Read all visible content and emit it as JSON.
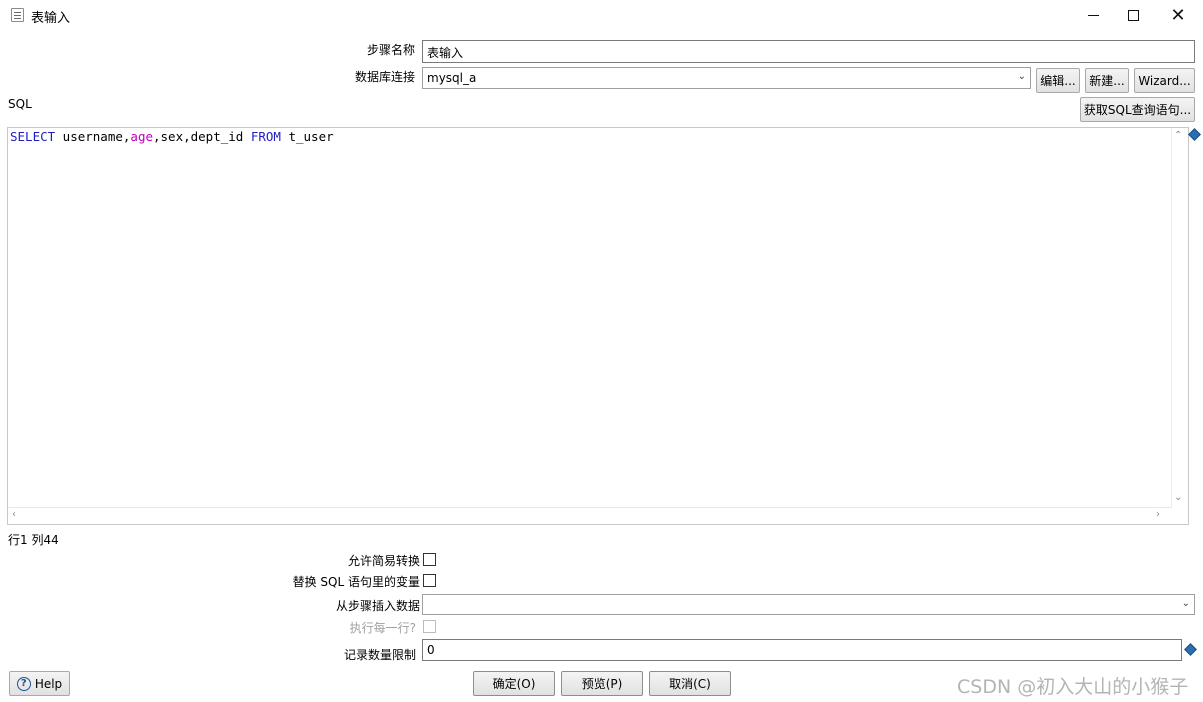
{
  "window": {
    "title": "表输入",
    "controls": {
      "minimize_icon": "minimize-icon",
      "maximize_icon": "maximize-icon",
      "close_icon": "close-icon"
    }
  },
  "form": {
    "step_name_label": "步骤名称",
    "step_name_value": "表输入",
    "db_conn_label": "数据库连接",
    "db_conn_value": "mysql_a",
    "edit_button": "编辑...",
    "new_button": "新建...",
    "wizard_button": "Wizard...",
    "sql_label": "SQL",
    "get_sql_button": "获取SQL查询语句..."
  },
  "editor": {
    "sql_tokens": [
      {
        "text": "SELECT",
        "kind": "keyword"
      },
      {
        "text": " username,",
        "kind": "plain"
      },
      {
        "text": "age",
        "kind": "function"
      },
      {
        "text": ",sex,dept_id ",
        "kind": "plain"
      },
      {
        "text": "FROM",
        "kind": "keyword"
      },
      {
        "text": " t_user",
        "kind": "plain"
      }
    ],
    "keyword_color": "#2020c0",
    "function_color": "#c000c0",
    "cursor_position": "行1 列44"
  },
  "options": {
    "lazy_conversion_label": "允许简易转换",
    "lazy_conversion_checked": false,
    "replace_vars_label": "替换 SQL 语句里的变量",
    "replace_vars_checked": false,
    "insert_from_step_label": "从步骤插入数据",
    "insert_from_step_value": "",
    "execute_each_row_label": "执行每一行?",
    "execute_each_row_checked": false,
    "limit_label": "记录数量限制",
    "limit_value": "0"
  },
  "footer": {
    "help_button": "Help",
    "ok_button": "确定(O)",
    "preview_button": "预览(P)",
    "cancel_button": "取消(C)",
    "watermark": "CSDN @初入大山的小猴子"
  }
}
